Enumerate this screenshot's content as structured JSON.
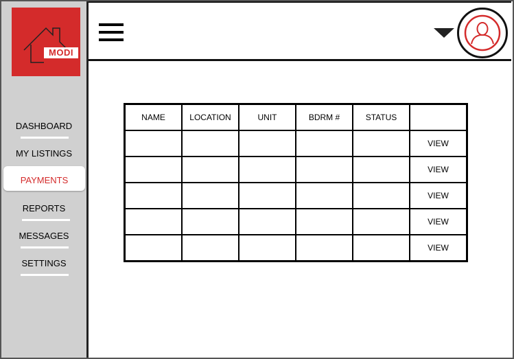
{
  "brand": {
    "logo_text": "MODI"
  },
  "sidebar": {
    "items": [
      {
        "label": "DASHBOARD",
        "active": false
      },
      {
        "label": "MY LISTINGS",
        "active": false
      },
      {
        "label": "PAYMENTS",
        "active": true
      },
      {
        "label": "REPORTS",
        "active": false
      },
      {
        "label": "MESSAGES",
        "active": false
      },
      {
        "label": "SETTINGS",
        "active": false
      }
    ]
  },
  "header": {
    "menu_icon": "hamburger-icon",
    "dropdown_icon": "caret-down-icon",
    "avatar_icon": "user-avatar-icon"
  },
  "table": {
    "columns": [
      "NAME",
      "LOCATION",
      "UNIT",
      "BDRM #",
      "STATUS",
      ""
    ],
    "rows": [
      {
        "name": "",
        "location": "",
        "unit": "",
        "bdrm": "",
        "status": "",
        "action": "VIEW"
      },
      {
        "name": "",
        "location": "",
        "unit": "",
        "bdrm": "",
        "status": "",
        "action": "VIEW"
      },
      {
        "name": "",
        "location": "",
        "unit": "",
        "bdrm": "",
        "status": "",
        "action": "VIEW"
      },
      {
        "name": "",
        "location": "",
        "unit": "",
        "bdrm": "",
        "status": "",
        "action": "VIEW"
      },
      {
        "name": "",
        "location": "",
        "unit": "",
        "bdrm": "",
        "status": "",
        "action": "VIEW"
      }
    ]
  },
  "colors": {
    "brand_red": "#d42b2b",
    "sidebar_bg": "#d0d0d0"
  }
}
